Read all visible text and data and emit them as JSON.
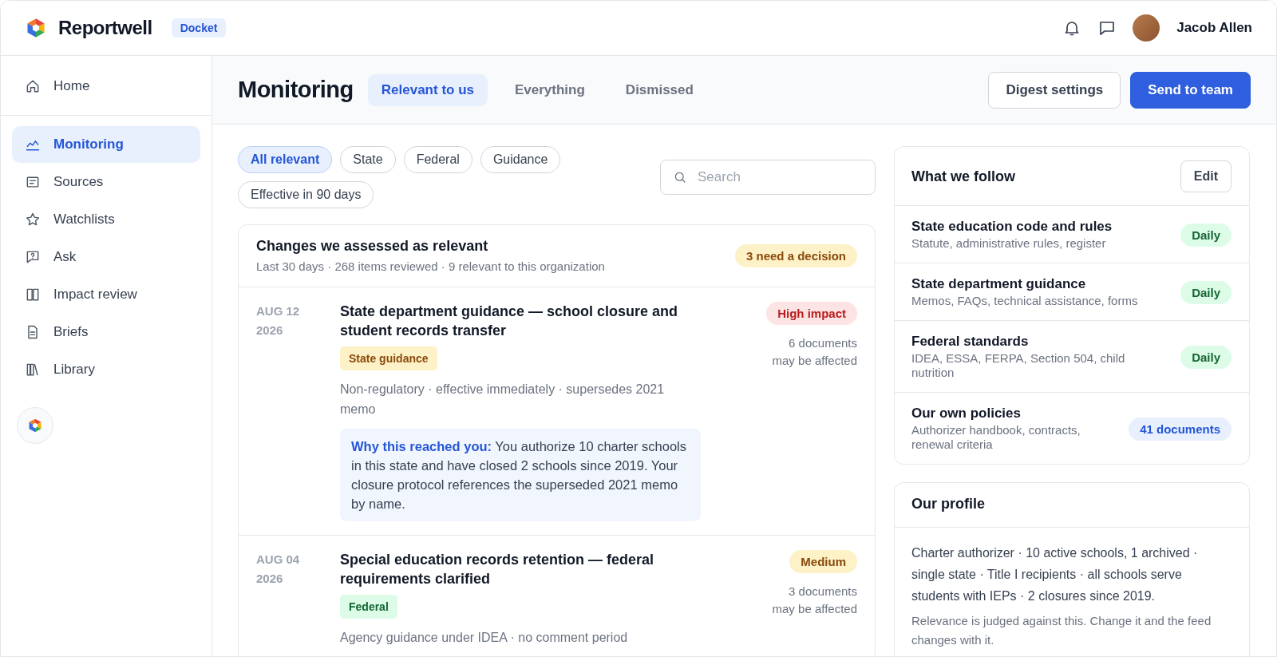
{
  "app": {
    "name": "Reportwell",
    "badge": "Docket"
  },
  "user": {
    "name": "Jacob Allen"
  },
  "sidebar": {
    "items": [
      {
        "label": "Home",
        "selected": false
      },
      {
        "label": "Monitoring",
        "selected": true
      },
      {
        "label": "Sources",
        "selected": false
      },
      {
        "label": "Watchlists",
        "selected": false
      },
      {
        "label": "Ask",
        "selected": false
      },
      {
        "label": "Impact review",
        "selected": false
      },
      {
        "label": "Briefs",
        "selected": false
      },
      {
        "label": "Library",
        "selected": false
      }
    ]
  },
  "page": {
    "title": "Monitoring",
    "tabs": [
      {
        "label": "Relevant to us",
        "selected": true
      },
      {
        "label": "Everything",
        "selected": false
      },
      {
        "label": "Dismissed",
        "selected": false
      }
    ],
    "actions": [
      {
        "label": "Digest settings",
        "kind": "secondary"
      },
      {
        "label": "Send to team",
        "kind": "primary"
      }
    ]
  },
  "filters": {
    "chips": [
      {
        "label": "All relevant",
        "selected": true
      },
      {
        "label": "State",
        "selected": false
      },
      {
        "label": "Federal",
        "selected": false
      },
      {
        "label": "Guidance",
        "selected": false
      },
      {
        "label": "Effective in 90 days",
        "selected": false
      }
    ],
    "search": {
      "placeholder": "Search"
    }
  },
  "feed": {
    "title": "Changes we assessed as relevant",
    "summary": "Last 30 days · 268 items reviewed · 9 relevant to this organization",
    "badge": "3 need a decision",
    "items": [
      {
        "date": "AUG 12 2026",
        "title": "State department guidance — school closure and student records transfer",
        "tag": {
          "label": "State guidance",
          "kind": "state"
        },
        "meta": "Non-regulatory · effective immediately · supersedes 2021 memo",
        "impact": {
          "label": "High impact",
          "kind": "high"
        },
        "affected": "6 documents may be affected",
        "why": "**Why this reached you:** You authorize 10 charter schools in this state and have closed 2 schools since 2019. Your closure protocol references the superseded 2021 memo by name."
      },
      {
        "date": "AUG 04 2026",
        "title": "Special education records retention — federal requirements clarified",
        "tag": {
          "label": "Federal",
          "kind": "federal"
        },
        "meta": "Agency guidance under IDEA · no comment period",
        "impact": {
          "label": "Medium",
          "kind": "medium"
        },
        "affected": "3 documents may be affected"
      }
    ]
  },
  "follow": {
    "title": "What we follow",
    "edit": "Edit",
    "rows": [
      {
        "name": "State education code and rules",
        "detail": "Statute, administrative rules, register",
        "badge": {
          "label": "Daily",
          "kind": "frequency"
        }
      },
      {
        "name": "State department guidance",
        "detail": "Memos, FAQs, technical assistance, forms",
        "badge": {
          "label": "Daily",
          "kind": "frequency"
        }
      },
      {
        "name": "Federal standards",
        "detail": "IDEA, ESSA, FERPA, Section 504, child nutrition",
        "badge": {
          "label": "Daily",
          "kind": "frequency"
        }
      },
      {
        "name": "Our own policies",
        "detail": "Authorizer handbook, contracts, renewal criteria",
        "badge": {
          "label": "41 documents",
          "kind": "count"
        }
      }
    ]
  },
  "profile": {
    "title": "Our profile",
    "text": "Charter authorizer · 10 active schools, 1 archived · single state · Title I recipients · all schools serve students with IEPs · 2 closures since 2019.",
    "note": "Relevance is judged against this. Change it and the feed changes with it."
  }
}
